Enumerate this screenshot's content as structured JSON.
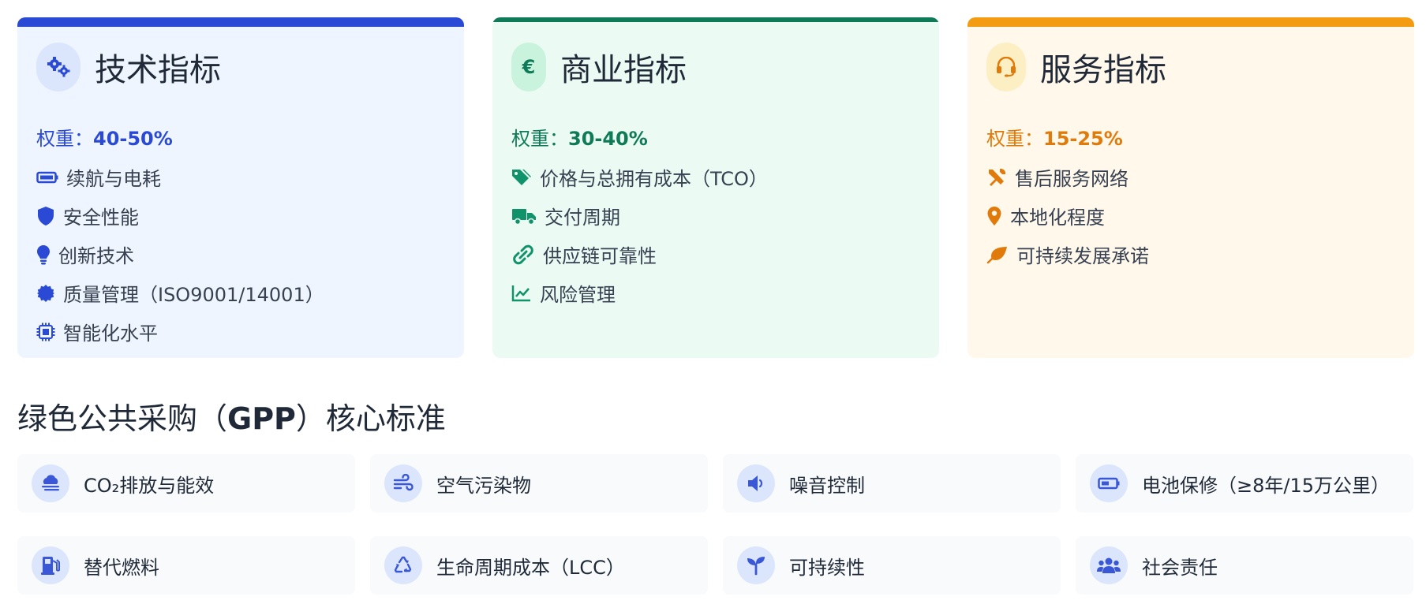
{
  "colors": {
    "tech": "#2a49d4",
    "business": "#0e7a57",
    "service": "#f39c12",
    "tech_bg": "#eff5ff",
    "business_bg": "#ebfbf3",
    "service_bg": "#fff8eb"
  },
  "cards": [
    {
      "title": "技术指标",
      "head_icon": "gears-icon",
      "weight_label": "权重：",
      "weight_value": "40-50%",
      "items": [
        {
          "icon": "battery-icon",
          "label": "续航与电耗"
        },
        {
          "icon": "shield-icon",
          "label": "安全性能"
        },
        {
          "icon": "lightbulb-icon",
          "label": "创新技术"
        },
        {
          "icon": "certificate-icon",
          "label": "质量管理（ISO9001/14001）"
        },
        {
          "icon": "chip-icon",
          "label": "智能化水平"
        }
      ]
    },
    {
      "title": "商业指标",
      "head_icon": "euro-icon",
      "weight_label": "权重：",
      "weight_value": "30-40%",
      "items": [
        {
          "icon": "tags-icon",
          "label": "价格与总拥有成本（TCO）"
        },
        {
          "icon": "truck-icon",
          "label": "交付周期"
        },
        {
          "icon": "link-icon",
          "label": "供应链可靠性"
        },
        {
          "icon": "chart-line-icon",
          "label": "风险管理"
        }
      ]
    },
    {
      "title": "服务指标",
      "head_icon": "headset-icon",
      "weight_label": "权重：",
      "weight_value": "15-25%",
      "items": [
        {
          "icon": "tools-icon",
          "label": "售后服务网络"
        },
        {
          "icon": "map-pin-icon",
          "label": "本地化程度"
        },
        {
          "icon": "leaf-icon",
          "label": "可持续发展承诺"
        }
      ]
    }
  ],
  "gpp": {
    "title_pre": "绿色公共采购（",
    "title_bold": "GPP",
    "title_post": "）核心标准",
    "tiles": [
      {
        "icon": "smog-icon",
        "label": "CO₂排放与能效"
      },
      {
        "icon": "wind-icon",
        "label": "空气污染物"
      },
      {
        "icon": "volume-icon",
        "label": "噪音控制"
      },
      {
        "icon": "battery-icon",
        "label": "电池保修（≥8年/15万公里）"
      },
      {
        "icon": "gas-pump-icon",
        "label": "替代燃料"
      },
      {
        "icon": "recycle-icon",
        "label": "生命周期成本（LCC）"
      },
      {
        "icon": "seedling-icon",
        "label": "可持续性"
      },
      {
        "icon": "users-icon",
        "label": "社会责任"
      }
    ]
  }
}
